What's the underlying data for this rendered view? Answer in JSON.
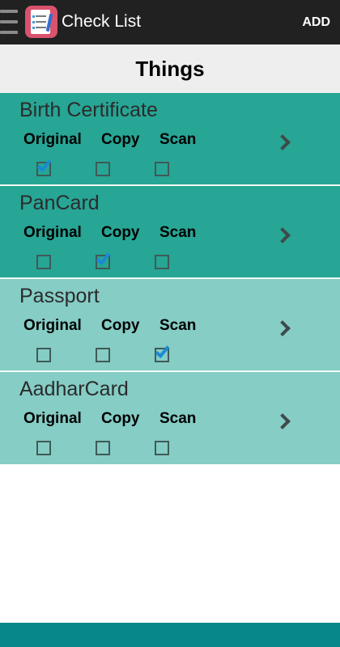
{
  "app_bar": {
    "title": "Check List",
    "add_label": "ADD",
    "menu_icon": "hamburger-menu-icon",
    "app_icon": "checklist-app-icon"
  },
  "header": {
    "title": "Things"
  },
  "columns": {
    "original": "Original",
    "copy": "Copy",
    "scan": "Scan"
  },
  "items": [
    {
      "name": "Birth Certificate",
      "original": true,
      "copy": false,
      "scan": false
    },
    {
      "name": "PanCard",
      "original": false,
      "copy": true,
      "scan": false
    },
    {
      "name": "Passport",
      "original": false,
      "copy": false,
      "scan": true
    },
    {
      "name": "AadharCard",
      "original": false,
      "copy": false,
      "scan": false
    }
  ],
  "colors": {
    "app_bar": "#212121",
    "item_dark": "#27a595",
    "item_light": "#85cdc5",
    "checkmark": "#1a8ad4",
    "footer": "#08878a"
  },
  "icons": {
    "row_action": "chevron-right-icon"
  }
}
